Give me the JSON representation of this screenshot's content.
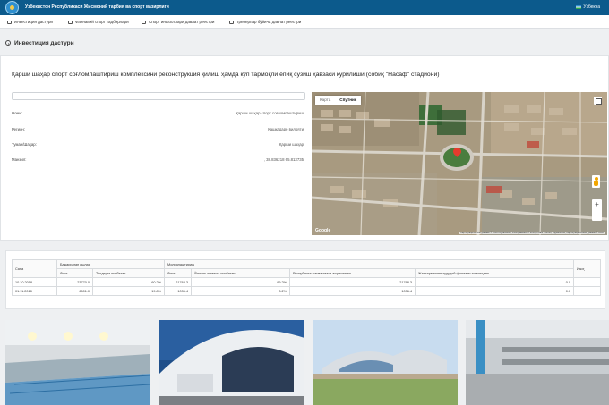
{
  "topbar": {
    "ministry": "Ўзбекистон Республикаси Жисмоний тарбия ва спорт вазирлиги",
    "user": "Ўзбекча"
  },
  "nav": [
    {
      "label": "Инвестиция дастури"
    },
    {
      "label": "Фаннавий спорт тадбирлари"
    },
    {
      "label": "Спорт иншоотлари давлат реестри"
    },
    {
      "label": "Тренерлар бўйича давлат реестри"
    }
  ],
  "page": {
    "title": "Инвестиция дастури"
  },
  "project": {
    "title": "Қарши шаҳар спорт соғломлаштириш комплексини реконструкция қилиш ҳамда кўп тармоқли ёпиқ сузиш ҳавзаси қурилиши (собиқ \"Насаф\" стадиони)",
    "fields": [
      {
        "label": "Номи:",
        "value": "Қарши шаҳар спорт соғломлаштириш"
      },
      {
        "label": "Регион:",
        "value": "Қашқадарё вилояти"
      },
      {
        "label": "Туман/Шаҳар:",
        "value": "Қарши шаҳар"
      },
      {
        "label": "Манзил:",
        "value": ", 38.836218 65.813735"
      }
    ]
  },
  "map": {
    "tab_map": "Карта",
    "tab_satellite": "Спутник",
    "zoom_in": "+",
    "zoom_out": "−",
    "logo": "Google",
    "attribution": "Картографические данные © 2018 DigitalGlobe, Изображения © 2018, CNES / Airbus, DigitalGlobe, Картографические данные © 2018"
  },
  "table": {
    "col_date": "Сана",
    "group_financing": "Бажарилган ишлар",
    "group_development": "Молиялаштириш",
    "col_fact": "Факт",
    "col_relative": "Тендерга нисбатан",
    "col_fact2": "Факт",
    "col_annual_plan": "Йиллик лимитга нисбатан",
    "col_republic": "Республика жамғармаси ажратилган",
    "col_parts": "Жамғарманинг худудий филиали томонидан",
    "col_note": "Изоҳ",
    "rows": [
      {
        "date": "10.10.2018",
        "fact": "23770.0",
        "rel": "60.2%",
        "fact2": "21768.3",
        "annual": "99.2%",
        "republic": "21768.3",
        "parts": "0.0"
      },
      {
        "date": "01.11.2018",
        "fact": "6501.0",
        "rel": "19.8%",
        "fact2": "1036.4",
        "annual": "3.2%",
        "republic": "1036.4",
        "parts": "0.0"
      }
    ]
  }
}
